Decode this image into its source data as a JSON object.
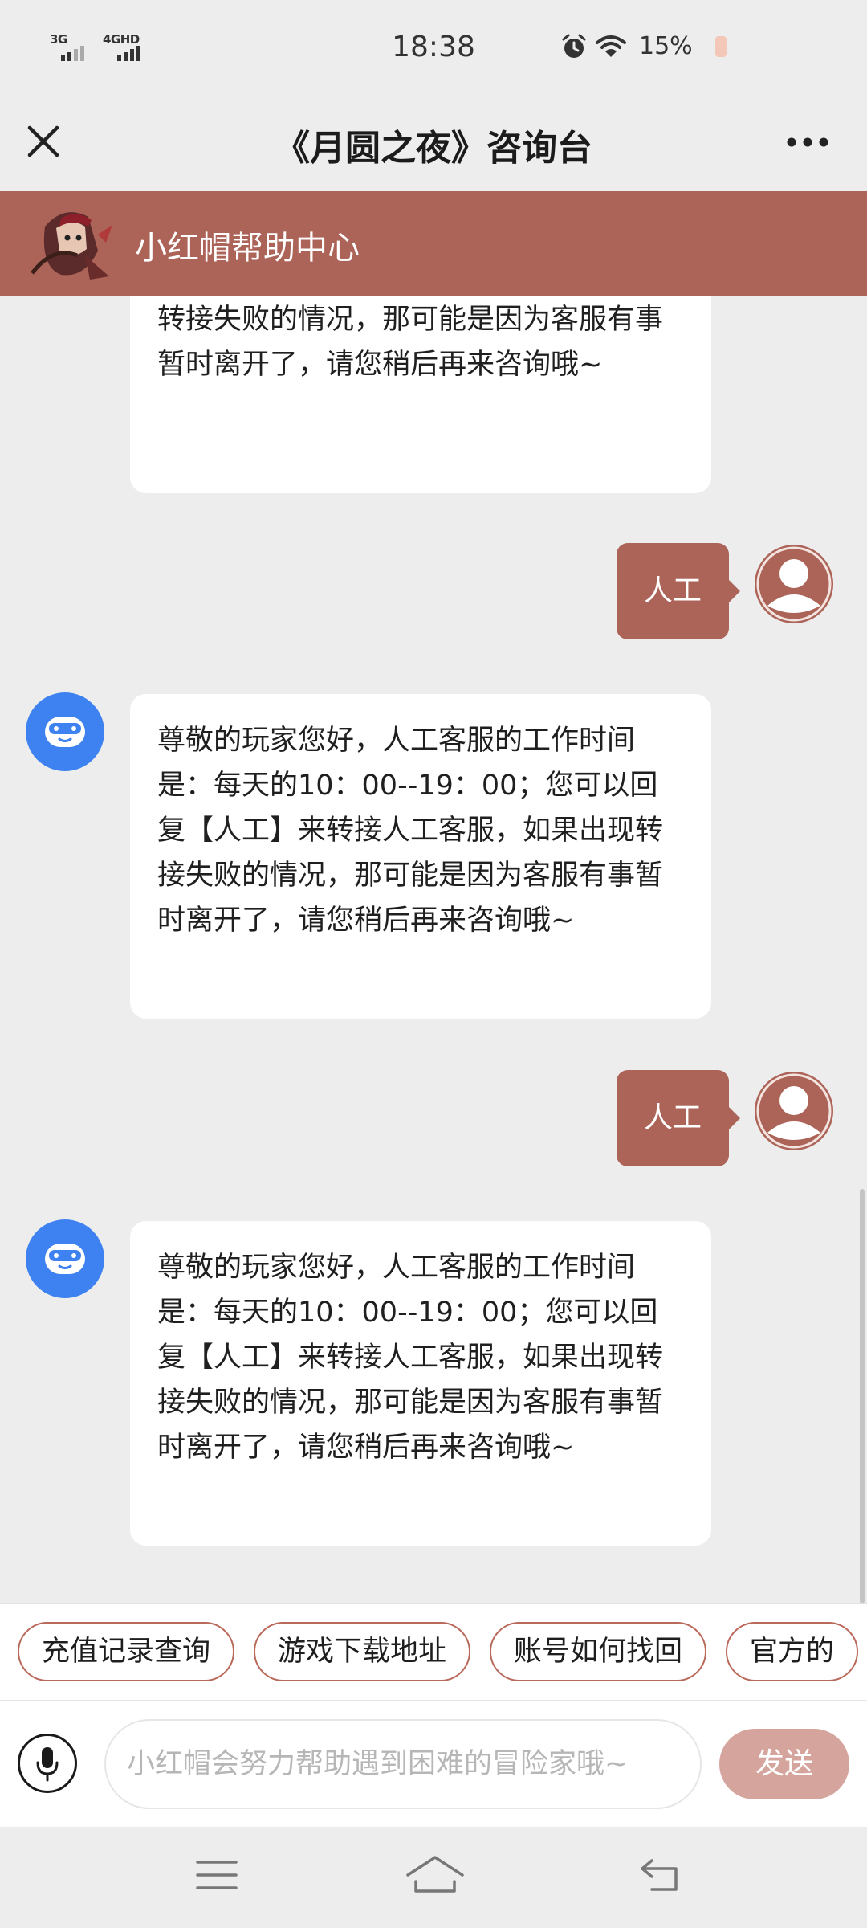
{
  "status_bar": {
    "network_1": "3G",
    "network_2": "4GHD",
    "time": "18:38",
    "battery": "15%",
    "icons": [
      "alarm-icon",
      "wifi-icon",
      "battery-icon"
    ]
  },
  "nav": {
    "title": "《月圆之夜》咨询台",
    "close_icon": "close-icon",
    "more_icon": "more-icon"
  },
  "brand": {
    "name": "小红帽帮助中心",
    "color": "#ad6458"
  },
  "messages": [
    {
      "sender": "bot",
      "text": "回复【人工】来转接人工客服，如果出现转接失败的情况，那可能是因为客服有事暂时离开了，请您稍后再来咨询哦~"
    },
    {
      "sender": "user",
      "text": "人工"
    },
    {
      "sender": "bot",
      "text": "尊敬的玩家您好，人工客服的工作时间是：每天的10：00--19：00；您可以回复【人工】来转接人工客服，如果出现转接失败的情况，那可能是因为客服有事暂时离开了，请您稍后再来咨询哦~"
    },
    {
      "sender": "user",
      "text": "人工"
    },
    {
      "sender": "bot",
      "text": "尊敬的玩家您好，人工客服的工作时间是：每天的10：00--19：00；您可以回复【人工】来转接人工客服，如果出现转接失败的情况，那可能是因为客服有事暂时离开了，请您稍后再来咨询哦~"
    }
  ],
  "quick_replies": [
    "充值记录查询",
    "游戏下载地址",
    "账号如何找回",
    "官方的"
  ],
  "input": {
    "placeholder": "小红帽会努力帮助遇到困难的冒险家哦~",
    "value": "",
    "send_label": "发送"
  },
  "colors": {
    "accent": "#ad6458",
    "bot_avatar": "#3d82f0",
    "send_disabled": "#d5a59d",
    "background": "#ededed"
  }
}
